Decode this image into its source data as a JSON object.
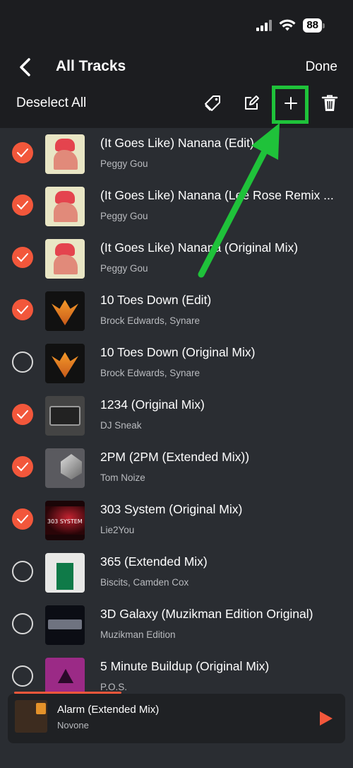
{
  "status": {
    "battery": "88"
  },
  "header": {
    "title": "All Tracks",
    "done_label": "Done",
    "deselect_label": "Deselect All"
  },
  "colors": {
    "accent": "#f2573b",
    "annotation": "#1fc23a",
    "background": "#2a2d32",
    "header_bg": "#1c1d20"
  },
  "toolbar": {
    "icons": [
      "tag-icon",
      "edit-icon",
      "add-icon",
      "trash-icon"
    ]
  },
  "tracks": [
    {
      "title": "(It Goes Like) Nanana (Edit)",
      "artist": "Peggy Gou",
      "selected": true
    },
    {
      "title": "(It Goes Like) Nanana (Lee Rose Remix ...",
      "artist": "Peggy Gou",
      "selected": true
    },
    {
      "title": "(It Goes Like) Nanana (Original Mix)",
      "artist": "Peggy Gou",
      "selected": true
    },
    {
      "title": "10 Toes Down (Edit)",
      "artist": "Brock Edwards, Synare",
      "selected": true
    },
    {
      "title": "10 Toes Down (Original Mix)",
      "artist": "Brock Edwards, Synare",
      "selected": false
    },
    {
      "title": "1234 (Original Mix)",
      "artist": "DJ Sneak",
      "selected": true
    },
    {
      "title": "2PM (2PM (Extended Mix))",
      "artist": "Tom Noize",
      "selected": true
    },
    {
      "title": "303 System (Original Mix)",
      "artist": "Lie2You",
      "selected": true
    },
    {
      "title": "365 (Extended Mix)",
      "artist": "Biscits, Camden Cox",
      "selected": false
    },
    {
      "title": "3D Galaxy (Muzikman Edition Original)",
      "artist": "Muzikman Edition",
      "selected": false
    },
    {
      "title": "5 Minute Buildup (Original Mix)",
      "artist": "P.O.S.",
      "selected": false
    }
  ],
  "artwork": {
    "303_label": "303 SYSTEM"
  },
  "now_playing": {
    "title": "Alarm (Extended Mix)",
    "artist": "Novone",
    "progress": 0.3
  }
}
